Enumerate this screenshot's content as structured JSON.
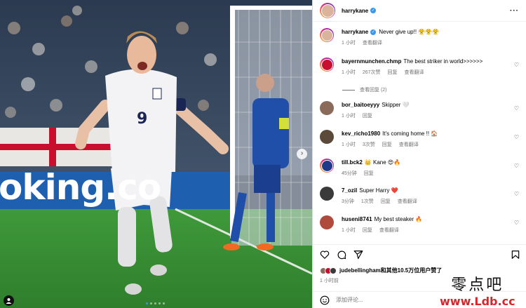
{
  "post": {
    "username": "harrykane",
    "caption": "Never give up!! 😤😤😤",
    "caption_time": "1 小时",
    "caption_translate": "查看翻译",
    "banner_text": "oking.co"
  },
  "comments": [
    {
      "username": "bayernmunchen.chmp",
      "text": "The best striker in world>>>>>>",
      "time": "1 小时",
      "likes": "267次赞",
      "reply": "回复",
      "translate": "查看翻译",
      "avatar_color": "#c8102e"
    },
    {
      "username": "bor_baitoeyyy",
      "text": "Skipper 🤍",
      "time": "1 小时",
      "reply": "回复",
      "avatar_color": "#8a6a5a"
    },
    {
      "username": "kev_richo1980",
      "text": "It's coming home !! 🏠",
      "time": "1 小时",
      "likes": "3次赞",
      "reply": "回复",
      "translate": "查看翻译",
      "avatar_color": "#5b4a3a"
    },
    {
      "username": "till.bck2",
      "text": "👑 Kane 😍🔥",
      "time": "45分钟",
      "reply": "回复",
      "avatar_color": "#1d3b8a"
    },
    {
      "username": "7_ozil",
      "text": "Super Harry ❤️",
      "time": "3分钟",
      "likes": "1次赞",
      "reply": "回复",
      "translate": "查看翻译",
      "avatar_color": "#3a3a3a"
    },
    {
      "username": "huseni8741",
      "text": "My best steaker 🔥",
      "time": "1 小时",
      "reply": "回复",
      "translate": "查看翻译",
      "avatar_color": "#b04a3c"
    }
  ],
  "view_replies": "查看回复 (2)",
  "likes_line": {
    "user": "judebellingham",
    "rest": "和其他10.5万位用户赞了"
  },
  "time_ago": "1 小时前",
  "add_comment_placeholder": "添加评论...",
  "icons": [
    "heart-icon",
    "comment-icon",
    "share-icon",
    "bookmark-icon",
    "emoji-icon",
    "more-icon",
    "tag-user-icon",
    "next-arrow-icon"
  ],
  "colors": {
    "verified": "#3897f0",
    "active_dot": "#3897f0",
    "like_heart": "#ed4956"
  },
  "watermark": {
    "cn": "零点吧",
    "url": "www.Ldb.cc"
  }
}
